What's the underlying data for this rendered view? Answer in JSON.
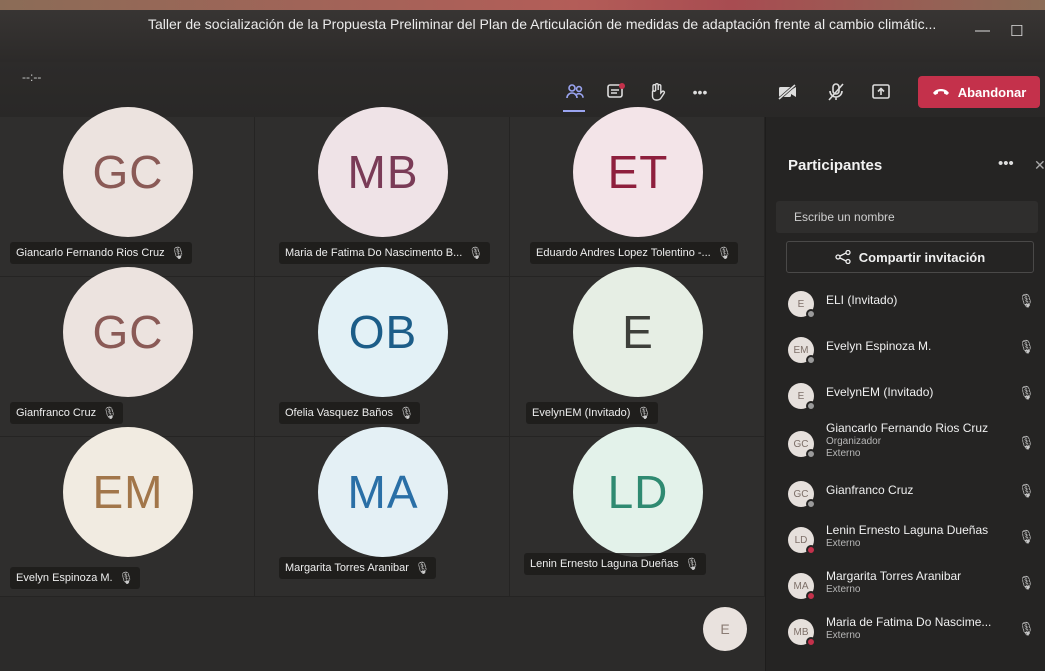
{
  "window": {
    "title": "Taller de socialización de la Propuesta Preliminar del Plan de Articulación de medidas de adaptación frente al cambio climátic...",
    "minimize_glyph": "—",
    "maximize_glyph": "☐"
  },
  "toolbar": {
    "timer": "--:--",
    "leave_label": "Abandonar",
    "icons": {
      "participants": "people-icon",
      "chat": "chat-icon",
      "raise_hand": "hand-icon",
      "more": "more-icon",
      "camera": "camera-off-icon",
      "mic": "mic-off-icon",
      "share": "share-screen-icon"
    },
    "more_glyph": "•••"
  },
  "grid": {
    "tiles": [
      {
        "initials": "GC",
        "name": "Giancarlo Fernando Rios Cruz",
        "color": "#8a5a56",
        "bg": "#ece3df"
      },
      {
        "initials": "MB",
        "name": "Maria de Fatima Do Nascimento B...",
        "color": "#7a3b57",
        "bg": "#efe3e7"
      },
      {
        "initials": "ET",
        "name": "Eduardo Andres Lopez Tolentino -...",
        "color": "#8e1f3d",
        "bg": "#f3e4e8"
      },
      {
        "initials": "GC",
        "name": "Gianfranco Cruz",
        "color": "#8a5a56",
        "bg": "#ece3df"
      },
      {
        "initials": "OB",
        "name": "Ofelia Vasquez Baños",
        "color": "#1c5d88",
        "bg": "#e3f1f6"
      },
      {
        "initials": "E",
        "name": "EvelynEM (Invitado)",
        "color": "#3d3f3a",
        "bg": "#e6eee4"
      },
      {
        "initials": "EM",
        "name": "Evelyn Espinoza M.",
        "color": "#a2764a",
        "bg": "#f1ebe1"
      },
      {
        "initials": "MA",
        "name": "Margarita Torres Aranibar",
        "color": "#2a6fa6",
        "bg": "#e4f0f5"
      },
      {
        "initials": "LD",
        "name": "Lenin Ernesto Laguna Dueñas",
        "color": "#2f8a71",
        "bg": "#e3f2ea"
      }
    ],
    "self_initial": "E"
  },
  "panel": {
    "title": "Participantes",
    "more_glyph": "•••",
    "close_glyph": "✕",
    "search_placeholder": "Escribe un nombre",
    "invite_label": "Compartir invitación",
    "participants": [
      {
        "initials": "E",
        "name": "ELI (Invitado)",
        "sub1": "",
        "sub2": "",
        "status": "offline"
      },
      {
        "initials": "EM",
        "name": "Evelyn Espinoza M.",
        "sub1": "",
        "sub2": "",
        "status": "offline"
      },
      {
        "initials": "E",
        "name": "EvelynEM (Invitado)",
        "sub1": "",
        "sub2": "",
        "status": "offline"
      },
      {
        "initials": "GC",
        "name": "Giancarlo Fernando Rios Cruz",
        "sub1": "Organizador",
        "sub2": "Externo",
        "status": "offline"
      },
      {
        "initials": "GC",
        "name": "Gianfranco Cruz",
        "sub1": "",
        "sub2": "",
        "status": "offline"
      },
      {
        "initials": "LD",
        "name": "Lenin Ernesto Laguna Dueñas",
        "sub1": "Externo",
        "sub2": "",
        "status": "busy"
      },
      {
        "initials": "MA",
        "name": "Margarita Torres Aranibar",
        "sub1": "Externo",
        "sub2": "",
        "status": "busy"
      },
      {
        "initials": "MB",
        "name": "Maria de Fatima Do Nascime...",
        "sub1": "Externo",
        "sub2": "",
        "status": "busy"
      }
    ]
  },
  "colors": {
    "leave": "#c4314b",
    "accent": "#9aa4f0",
    "panel_bg": "#252423"
  }
}
